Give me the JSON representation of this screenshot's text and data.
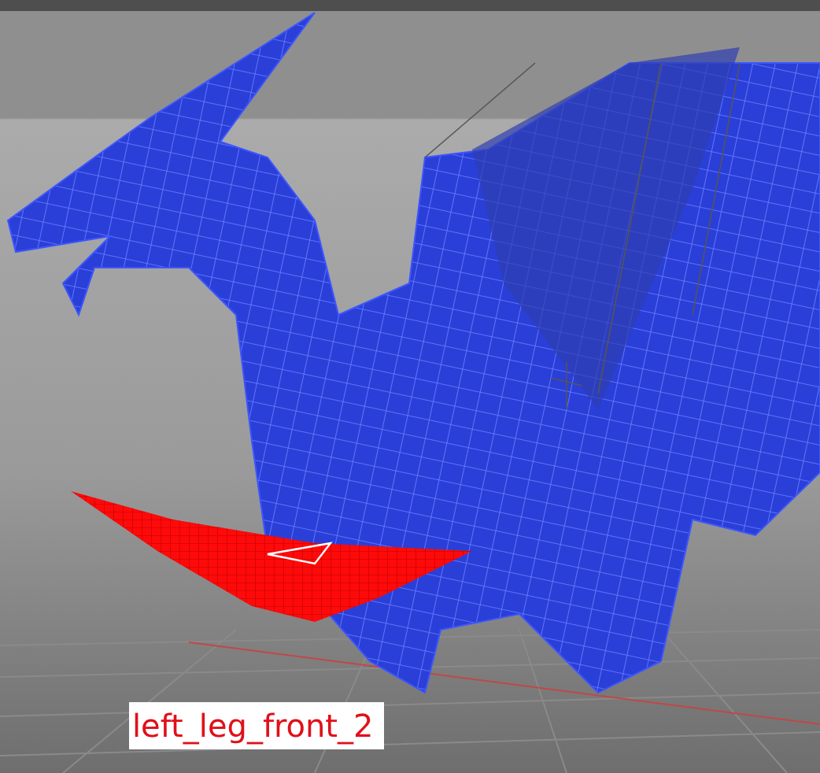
{
  "selection_label": "left_leg_front_2"
}
